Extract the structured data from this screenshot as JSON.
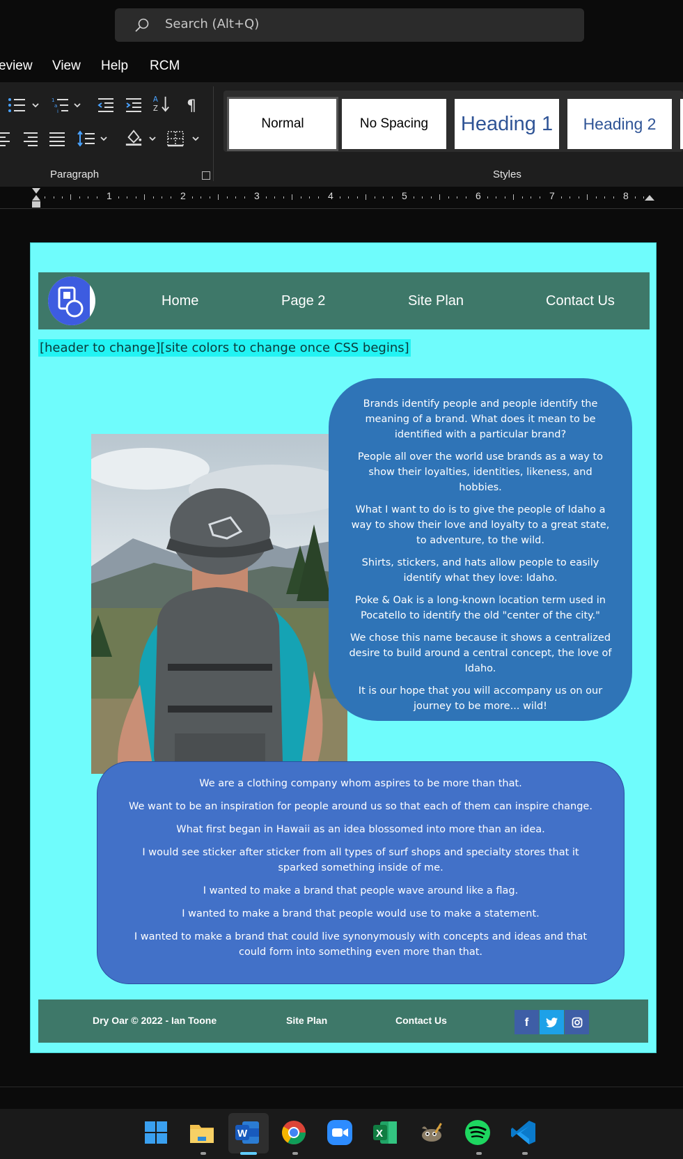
{
  "search": {
    "placeholder": "Search (Alt+Q)"
  },
  "menu": {
    "items": [
      "eview",
      "View",
      "Help",
      "RCM"
    ]
  },
  "ribbon": {
    "paragraph_label": "Paragraph",
    "styles_label": "Styles",
    "styles": [
      "Normal",
      "No Spacing",
      "Heading 1",
      "Heading 2"
    ],
    "heading_color": "#2f5496"
  },
  "ruler": {
    "numbers": [
      "1",
      "2",
      "3",
      "4",
      "5",
      "6",
      "7",
      "8"
    ]
  },
  "site": {
    "nav": [
      "Home",
      "Page 2",
      "Site Plan",
      "Contact Us"
    ],
    "header_note": "[header to change][site colors to change once CSS begins]",
    "card1": [
      "Brands identify people and people identify the meaning of a brand. What does it mean to be identified with a particular brand?",
      "People all over the world use brands as a way to show their loyalties, identities, likeness, and hobbies.",
      "What I want to do is to give the people of Idaho a way to show their love and loyalty to a great state, to adventure, to the wild.",
      "Shirts, stickers, and hats allow people to easily identify what they love: Idaho.",
      "Poke & Oak is a long-known location term used in Pocatello to identify the old \"center of the city.\"",
      "We chose this name because it shows a centralized desire to build around a central concept, the love of Idaho.",
      "It is our hope that you will accompany us on our journey to be more... wild!"
    ],
    "card2": [
      "We are a clothing company whom aspires to be more than that.",
      "We want to be an inspiration for people around us so that each of them can inspire change.",
      "What first began in Hawaii as an idea blossomed into more than an idea.",
      "I would see sticker after sticker from all types of surf shops and specialty stores that it sparked something inside of me.",
      "I wanted to make a brand that people wave around like a flag.",
      "I wanted to make a brand that people would use to make a statement.",
      "I wanted to make a brand that could live synonymously with concepts and ideas and that could form into something even more than that."
    ],
    "footer": {
      "copyright": "Dry Oar © 2022 - Ian Toone",
      "site_plan": "Site Plan",
      "contact": "Contact Us"
    },
    "colors": {
      "page_bg": "#6ffcfc",
      "nav_bg": "#3e7869",
      "card1_bg": "#2f74b7",
      "card2_bg": "#4271c8"
    }
  },
  "taskbar": {
    "apps": [
      "windows-start",
      "file-explorer",
      "word",
      "chrome",
      "zoom",
      "excel",
      "gimp",
      "spotify",
      "vscode"
    ]
  }
}
